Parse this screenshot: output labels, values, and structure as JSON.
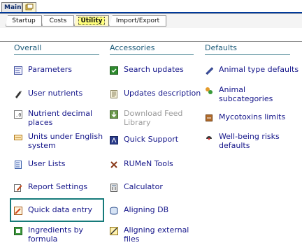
{
  "top_tabs": [
    {
      "label": "Main"
    },
    {
      "label": ""
    }
  ],
  "sub_tabs": [
    {
      "label": "Startup"
    },
    {
      "label": "Costs"
    },
    {
      "label": "Utility"
    },
    {
      "label": "Import/Export"
    }
  ],
  "columns": [
    {
      "title": "Overall",
      "items": [
        {
          "label": "Parameters",
          "icon": "parameters-icon"
        },
        {
          "label": "User nutrients",
          "icon": "nutrients-icon"
        },
        {
          "label": "Nutrient decimal places",
          "icon": "decimal-icon"
        },
        {
          "label": "Units under English system",
          "icon": "units-icon"
        },
        {
          "label": "User Lists",
          "icon": "list-icon"
        },
        {
          "label": "Report Settings",
          "icon": "report-settings-icon"
        },
        {
          "label": "Quick data entry",
          "icon": "quick-entry-icon"
        },
        {
          "label": "Ingredients by formula",
          "icon": "ingredients-icon"
        }
      ]
    },
    {
      "title": "Accessories",
      "items": [
        {
          "label": "Search updates",
          "icon": "search-updates-icon"
        },
        {
          "label": "Updates description",
          "icon": "document-icon"
        },
        {
          "label": "Download Feed Library",
          "icon": "download-icon"
        },
        {
          "label": "Quick Support",
          "icon": "support-icon"
        },
        {
          "label": "RUMeN Tools",
          "icon": "tools-icon"
        },
        {
          "label": "Calculator",
          "icon": "calculator-icon"
        },
        {
          "label": "Aligning DB",
          "icon": "database-icon"
        },
        {
          "label": "Aligning external files",
          "icon": "external-files-icon"
        }
      ]
    },
    {
      "title": "Defaults",
      "items": [
        {
          "label": "Animal type defaults",
          "icon": "animal-type-icon"
        },
        {
          "label": "Animal subcategories",
          "icon": "subcategories-icon"
        },
        {
          "label": "Mycotoxins limits",
          "icon": "mycotoxins-icon"
        },
        {
          "label": "Well-being risks defaults",
          "icon": "well-being-icon"
        }
      ]
    }
  ],
  "colors": {
    "link": "#15168a",
    "header": "#1c5a78",
    "rule": "#3c7c8c",
    "focus": "#167a7a",
    "disabled": "#9a9a9a"
  }
}
